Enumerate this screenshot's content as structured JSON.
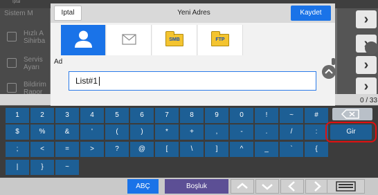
{
  "background": {
    "top_text": "Iptal",
    "system_label": "Sistem M",
    "menu_items": [
      {
        "label_line1": "Hızlı A",
        "label_line2": "Sihirba"
      },
      {
        "label_line1": "Servis",
        "label_line2": "Ayarı"
      },
      {
        "label_line1": "Bildirim",
        "label_line2": "Rapor"
      }
    ],
    "counter": "0 / 33"
  },
  "dialog": {
    "cancel_label": "Iptal",
    "title": "Yeni Adres",
    "save_label": "Kaydet",
    "type_tabs": [
      {
        "name": "contact",
        "icon": "person-icon",
        "selected": true
      },
      {
        "name": "email",
        "icon": "envelope-icon",
        "selected": false
      },
      {
        "name": "smb",
        "icon": "folder-icon",
        "label": "SMB",
        "selected": false
      },
      {
        "name": "ftp",
        "icon": "folder-icon",
        "label": "FTP",
        "selected": false
      }
    ],
    "name_label": "Ad",
    "name_value": "List#1"
  },
  "keyboard": {
    "row1": [
      "1",
      "2",
      "3",
      "4",
      "5",
      "6",
      "7",
      "8",
      "9",
      "0",
      "!",
      "~",
      "#"
    ],
    "row2": [
      "$",
      "%",
      "&",
      "'",
      "(",
      ")",
      "*",
      "+",
      ",",
      "-",
      ".",
      "/",
      ":"
    ],
    "row3": [
      ";",
      "<",
      "=",
      ">",
      "?",
      "@",
      "[",
      "\\",
      "]",
      "^",
      "_",
      "`",
      "{"
    ],
    "row4": [
      "|",
      "}",
      "~"
    ],
    "enter_label": "Gir",
    "abc_label": "ABÇ",
    "space_label": "Boşluk"
  },
  "colors": {
    "accent": "#1a73e8",
    "key": "#1d5f95",
    "highlight": "#e01010"
  }
}
